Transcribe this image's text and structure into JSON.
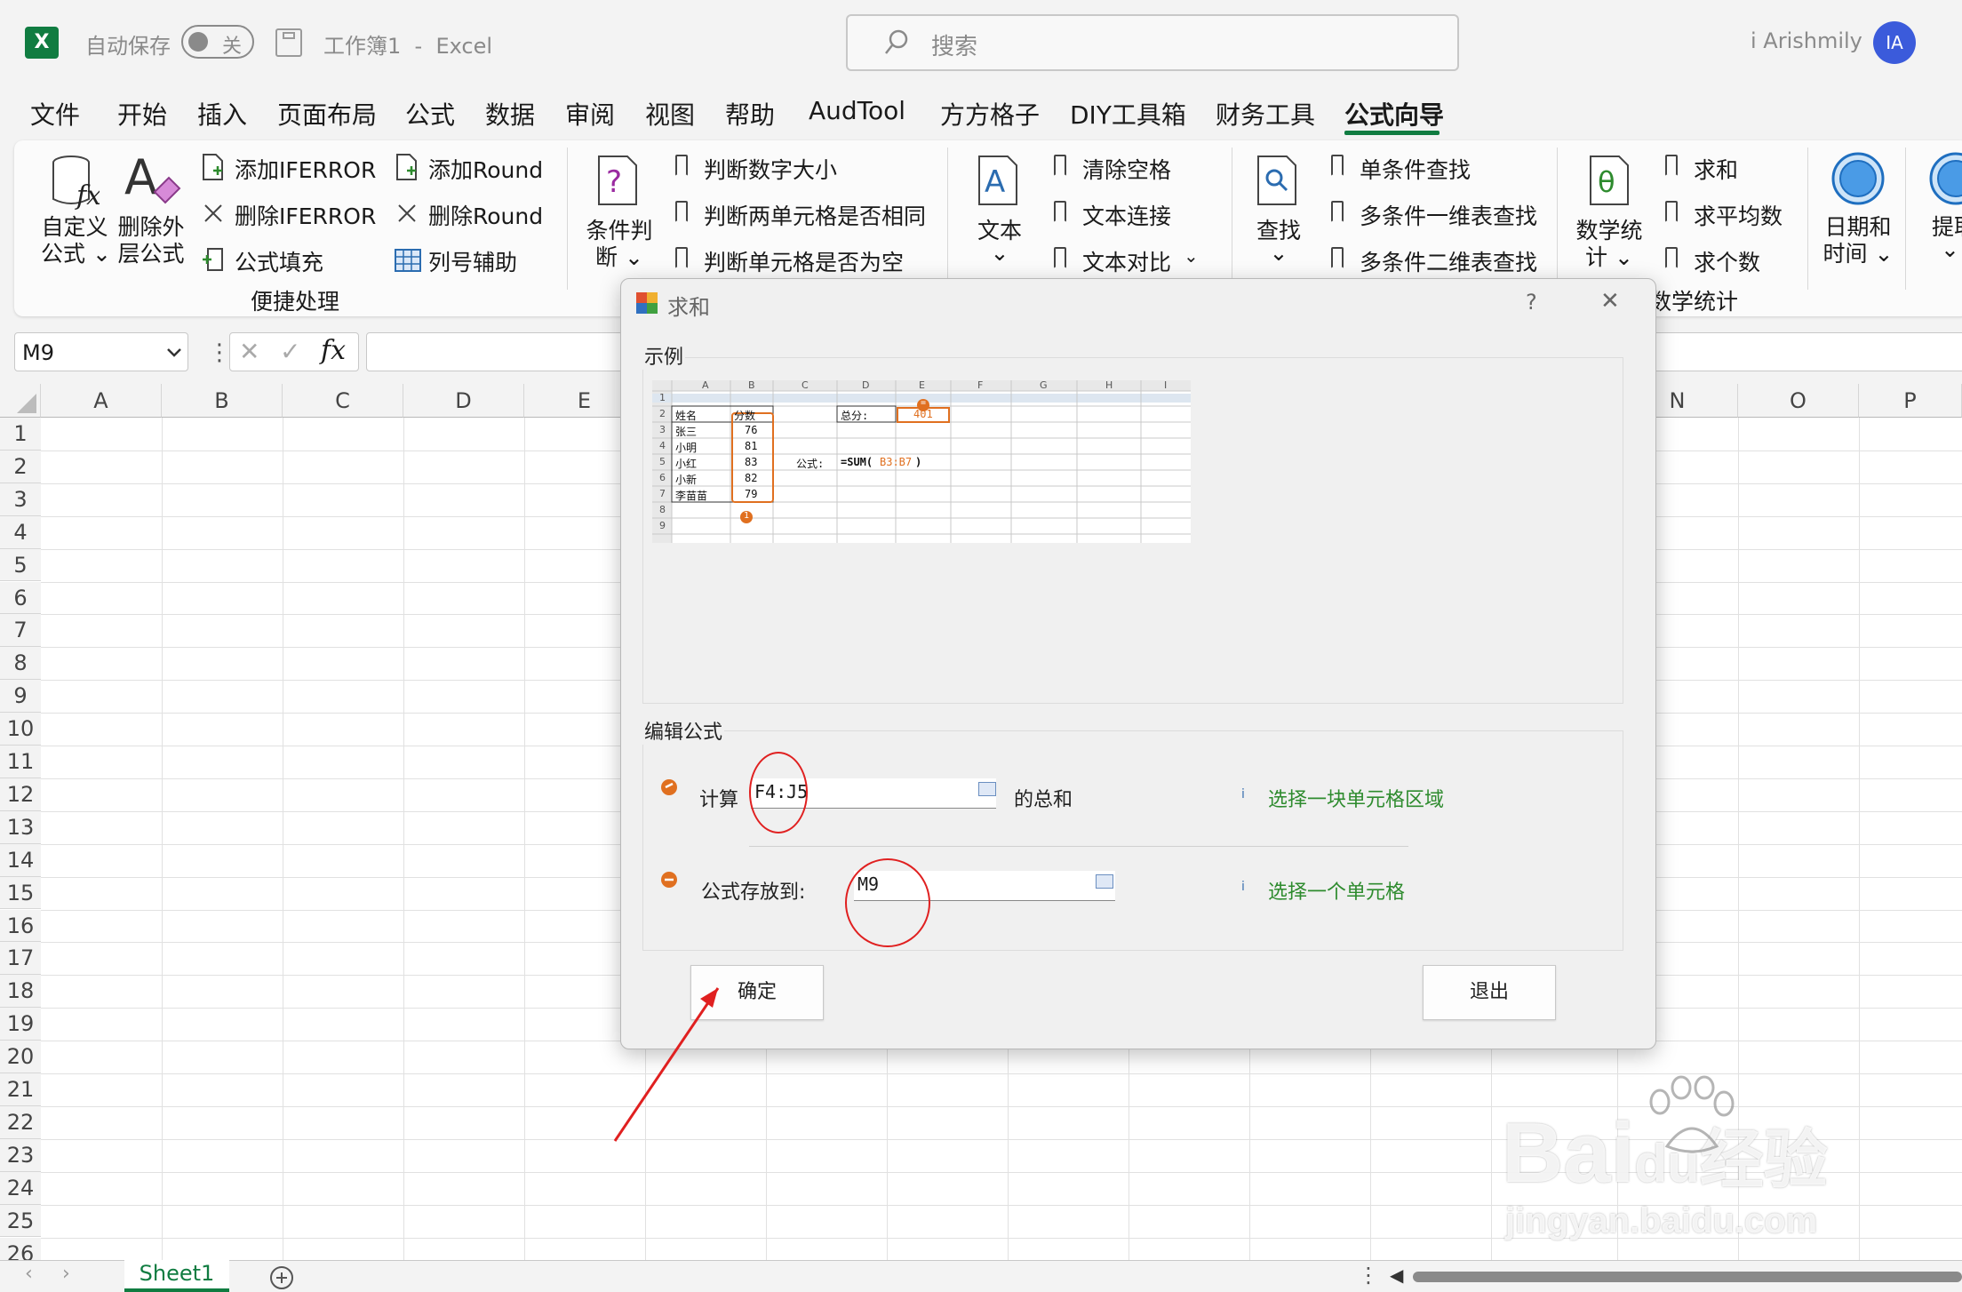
{
  "titlebar": {
    "app_icon": "X",
    "autosave_label": "自动保存",
    "toggle_state": "关",
    "workbook_title": "工作簿1  -  Excel",
    "search_placeholder": "搜索",
    "user_name": "i Arishmily",
    "user_initials": "IA"
  },
  "tabs": [
    "文件",
    "开始",
    "插入",
    "页面布局",
    "公式",
    "数据",
    "审阅",
    "视图",
    "帮助",
    "AudTool",
    "方方格子",
    "DIY工具箱",
    "财务工具",
    "公式向导"
  ],
  "active_tab": "公式向导",
  "ribbon": {
    "custom_formula": [
      "自定义",
      "公式 ⌄"
    ],
    "delete_outer": [
      "删除外",
      "层公式"
    ],
    "add_iferror": "添加IFERROR",
    "del_iferror": "删除IFERROR",
    "formula_fill": "公式填充",
    "add_round": "添加Round",
    "del_round": "删除Round",
    "col_helper": "列号辅助",
    "group_quick": "便捷处理",
    "condition": [
      "条件判",
      "断 ⌄"
    ],
    "judge_num": "判断数字大小",
    "judge_same": "判断两单元格是否相同",
    "judge_empty": "判断单元格是否为空",
    "text": [
      "文本",
      "⌄"
    ],
    "clear_space": "清除空格",
    "text_join": "文本连接",
    "text_compare": "文本对比",
    "lookup": [
      "查找",
      "⌄"
    ],
    "single_lookup": "单条件查找",
    "multi_1d": "多条件一维表查找",
    "multi_2d": "多条件二维表查找",
    "math": [
      "数学统",
      "计 ⌄"
    ],
    "sum": "求和",
    "avg": "求平均数",
    "count": "求个数",
    "group_math": "数学统计",
    "datetime": [
      "日期和",
      "时间 ⌄"
    ],
    "extract": [
      "提取",
      "⌄"
    ]
  },
  "formula_bar": {
    "name_box": "M9",
    "fx": "fx",
    "cancel": "✕",
    "confirm": "✓"
  },
  "columns": [
    "A",
    "B",
    "C",
    "D",
    "E",
    "N",
    "O",
    "P"
  ],
  "rows": [
    "1",
    "2",
    "3",
    "4",
    "5",
    "6",
    "7",
    "8",
    "9",
    "10",
    "11",
    "12",
    "13",
    "14",
    "15",
    "16",
    "17",
    "18",
    "19",
    "20",
    "21",
    "22",
    "23",
    "24",
    "25",
    "26"
  ],
  "sheet_tab": "Sheet1",
  "dialog": {
    "title": "求和",
    "help": "?",
    "close": "✕",
    "example_group": "示例",
    "edit_group": "编辑公式",
    "calc_label": "计算",
    "calc_value": "F4:J5",
    "sum_suffix": "的总和",
    "calc_hint": "选择一块单元格区域",
    "store_label": "公式存放到:",
    "store_value": "M9",
    "store_hint": "选择一个单元格",
    "ok": "确定",
    "exit": "退出"
  },
  "example": {
    "cols": [
      "A",
      "B",
      "C",
      "D",
      "E",
      "F",
      "G",
      "H",
      "I"
    ],
    "rows": [
      "1",
      "2",
      "3",
      "4",
      "5",
      "6",
      "7",
      "8",
      "9"
    ],
    "name_header": "姓名",
    "score_header": "分数",
    "names": [
      "张三",
      "小明",
      "小红",
      "小新",
      "李苗苗"
    ],
    "scores": [
      "76",
      "81",
      "83",
      "82",
      "79"
    ],
    "total_label": "总分:",
    "total_value": "401",
    "formula_label": "公式:",
    "formula_prefix": "=SUM(",
    "formula_range": "B3:B7",
    "formula_suffix": ")",
    "badge_1": "1",
    "badge_eq": "="
  },
  "watermark": {
    "brand": "Bai",
    "brand2": "du",
    "cn": "经验",
    "url": "jingyan.baidu.com"
  },
  "colors": {
    "excel_green": "#107c41",
    "accent_orange": "#e07020",
    "annotation_red": "#e02020",
    "link_green": "#2e8b2e"
  }
}
